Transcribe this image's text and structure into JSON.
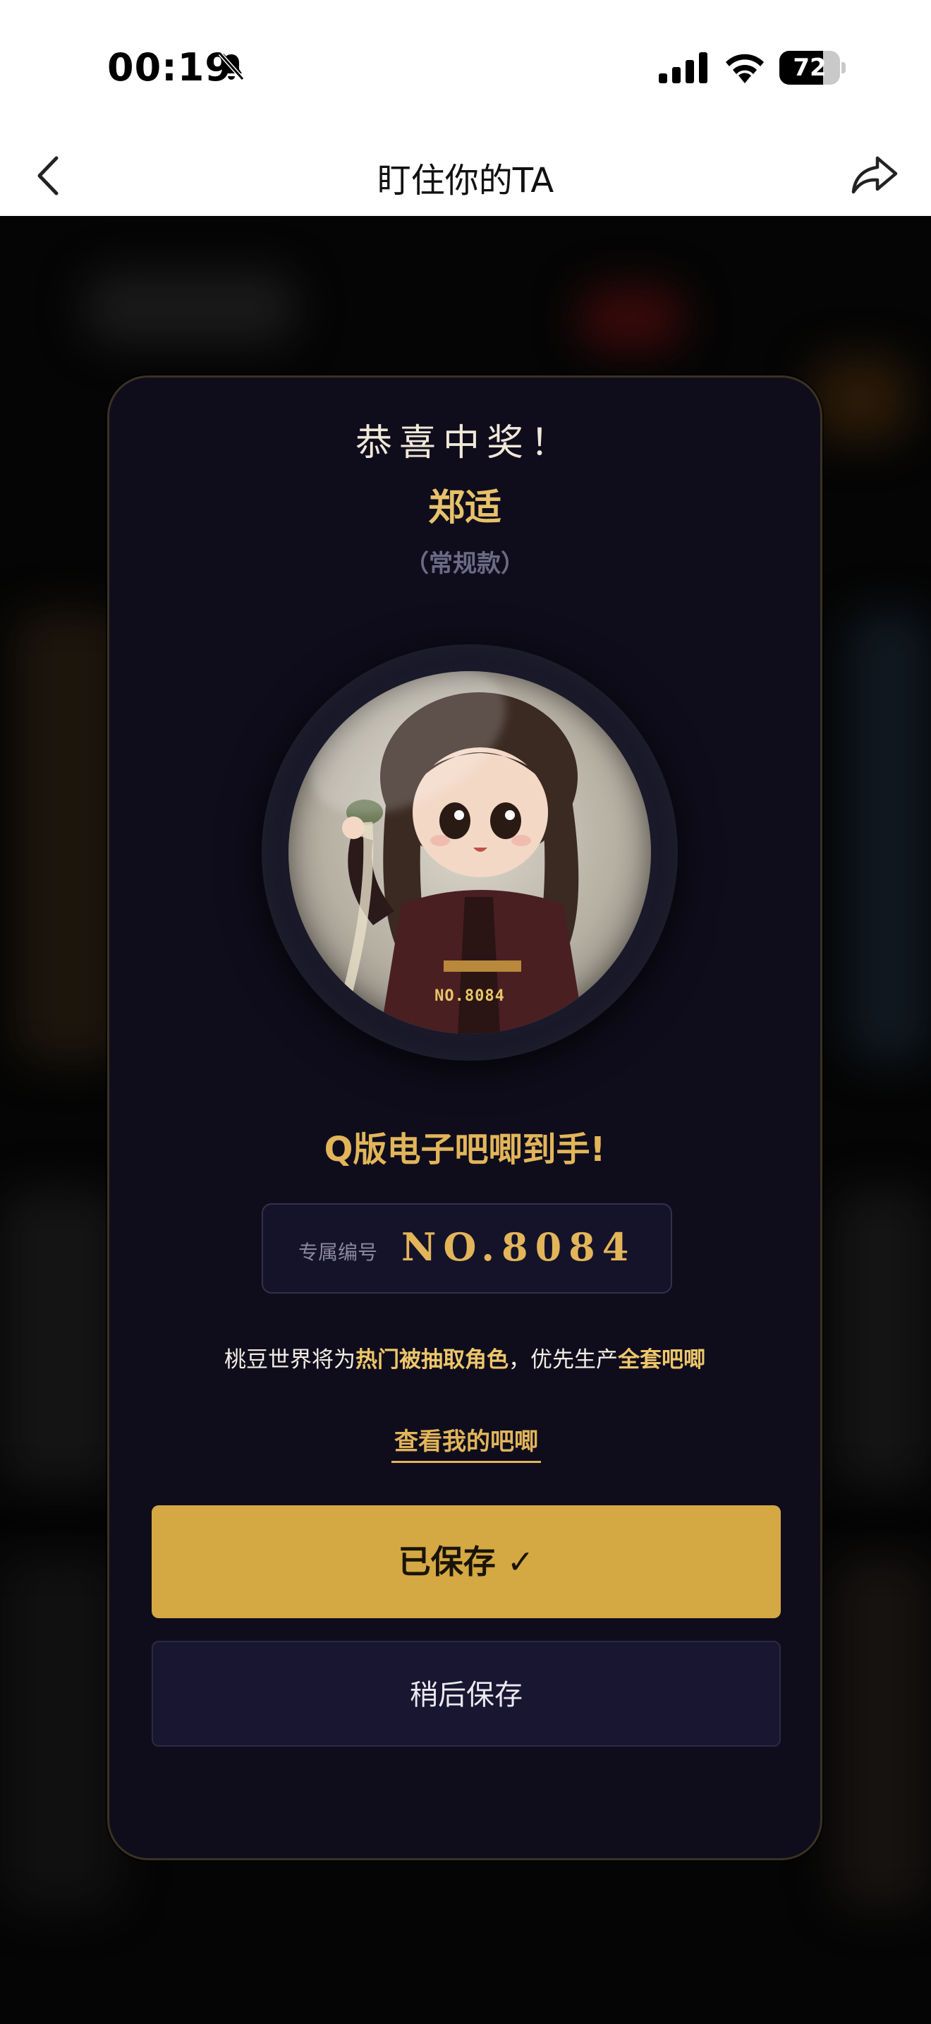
{
  "status_bar": {
    "time": "00:19",
    "battery_level": "72",
    "icons": [
      "bell-off-icon",
      "cellular-signal-icon",
      "wifi-icon",
      "battery-icon"
    ]
  },
  "nav": {
    "title": "盯住你的TA",
    "back_icon": "chevron-left-icon",
    "share_icon": "share-icon"
  },
  "card": {
    "congrats": "恭喜中奖！",
    "character_name": "郑适",
    "variant": "（常规款）",
    "badge_number": "NO.8084",
    "obtained_text": "Q版电子吧唧到手!",
    "serial_label": "专属编号",
    "serial_value": "NO.8084",
    "info_part1": "桃豆世界将为",
    "info_highlight1": "热门被抽取角色",
    "info_part2": "，优先生产",
    "info_highlight2": "全套吧唧",
    "view_link": "查看我的吧唧",
    "saved_button": "已保存 ✓",
    "later_button": "稍后保存"
  },
  "colors": {
    "accent_gold": "#d4a843",
    "highlight_gold": "#e2b55a",
    "card_bg": "#0f0d1c"
  }
}
